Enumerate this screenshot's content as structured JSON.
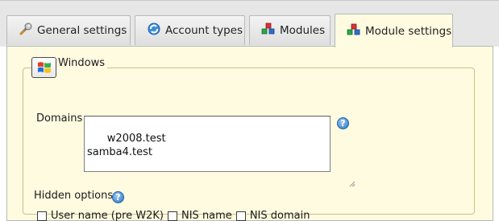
{
  "tabs": [
    {
      "label": "General settings",
      "icon": "wrench-icon",
      "active": false
    },
    {
      "label": "Account types",
      "icon": "refresh-icon",
      "active": false
    },
    {
      "label": "Modules",
      "icon": "modules-icon",
      "active": false
    },
    {
      "label": "Module settings",
      "icon": "modules-icon",
      "active": true
    }
  ],
  "section": {
    "title": "Windows",
    "icon": "windows-logo-icon"
  },
  "domains": {
    "label": "Domains",
    "value": "w2008.test\nsamba4.test"
  },
  "hidden_options": {
    "label": "Hidden options",
    "items": [
      {
        "label": "User name (pre W2K)",
        "checked": false
      },
      {
        "label": "NIS name",
        "checked": false
      },
      {
        "label": "NIS domain",
        "checked": false
      }
    ]
  },
  "colors": {
    "panel_bg": "#fffbe0",
    "tabbar_bg": "#e6e6e6",
    "help_blue": "#2a73c6"
  }
}
